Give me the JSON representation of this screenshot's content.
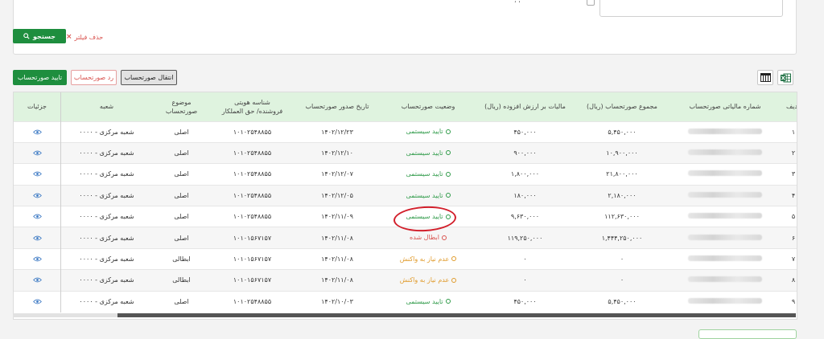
{
  "filter": {
    "clear_label": "حذف فیلتر",
    "search_label": "جستجو",
    "label_fragment": "، ،"
  },
  "actions": {
    "approve_label": "تایید صورتحساب",
    "reject_label": "رد صورتحساب",
    "transfer_label": "انتقال صورتحساب"
  },
  "table": {
    "headers": {
      "row": "ردیف",
      "tax_number": "شماره مالیاتی صورتحساب",
      "total": "مجموع صورتحساب (ریال)",
      "vat": "مالیات بر ارزش افزوده (ریال)",
      "status": "وضعیت صورتحساب",
      "issue_date": "تاریخ صدور صورتحساب",
      "id_line1": "شناسه هویتی",
      "id_line2": "فروشنده/ حق العملکار",
      "subject": "موضوع صورتحساب",
      "branch": "شعبه",
      "details": "جزئیات"
    },
    "rows": [
      {
        "row": "۱",
        "total": "۵,۴۵۰,۰۰۰",
        "vat": "۴۵۰,۰۰۰",
        "status": "تایید سیستمی",
        "status_type": "approved",
        "date": "۱۴۰۲/۱۲/۲۳",
        "id": "۱۰۱۰۲۵۴۸۸۵۵",
        "subject": "اصلی",
        "branch": "شعبه مرکزی - ۰۰۰۰"
      },
      {
        "row": "۲",
        "total": "۱۰,۹۰۰,۰۰۰",
        "vat": "۹۰۰,۰۰۰",
        "status": "تایید سیستمی",
        "status_type": "approved",
        "date": "۱۴۰۲/۱۲/۱۰",
        "id": "۱۰۱۰۲۵۴۸۸۵۵",
        "subject": "اصلی",
        "branch": "شعبه مرکزی - ۰۰۰۰"
      },
      {
        "row": "۳",
        "total": "۲۱,۸۰۰,۰۰۰",
        "vat": "۱,۸۰۰,۰۰۰",
        "status": "تایید سیستمی",
        "status_type": "approved",
        "date": "۱۴۰۲/۱۲/۰۷",
        "id": "۱۰۱۰۲۵۴۸۸۵۵",
        "subject": "اصلی",
        "branch": "شعبه مرکزی - ۰۰۰۰"
      },
      {
        "row": "۴",
        "total": "۲,۱۸۰,۰۰۰",
        "vat": "۱۸۰,۰۰۰",
        "status": "تایید سیستمی",
        "status_type": "approved",
        "date": "۱۴۰۲/۱۲/۰۵",
        "id": "۱۰۱۰۲۵۴۸۸۵۵",
        "subject": "اصلی",
        "branch": "شعبه مرکزی - ۰۰۰۰"
      },
      {
        "row": "۵",
        "total": "۱۱۲,۶۳۰,۰۰۰",
        "vat": "۹,۶۳۰,۰۰۰",
        "status": "تایید سیستمی",
        "status_type": "approved",
        "date": "۱۴۰۲/۱۱/۰۹",
        "id": "۱۰۱۰۲۵۴۸۸۵۵",
        "subject": "اصلی",
        "branch": "شعبه مرکزی - ۰۰۰۰"
      },
      {
        "row": "۶",
        "total": "۱,۴۴۴,۲۵۰,۰۰۰",
        "vat": "۱۱۹,۲۵۰,۰۰۰",
        "status": "ابطال شده",
        "status_type": "canceled",
        "date": "۱۴۰۲/۱۱/۰۸",
        "id": "۱۰۱۰۱۵۶۷۱۵۷",
        "subject": "اصلی",
        "branch": "شعبه مرکزی - ۰۰۰۰"
      },
      {
        "row": "۷",
        "total": "۰",
        "vat": "۰",
        "status": "عدم نیاز به واکنش",
        "status_type": "noneed",
        "date": "۱۴۰۲/۱۱/۰۸",
        "id": "۱۰۱۰۱۵۶۷۱۵۷",
        "subject": "ابطالی",
        "branch": "شعبه مرکزی - ۰۰۰۰"
      },
      {
        "row": "۸",
        "total": "۰",
        "vat": "۰",
        "status": "عدم نیاز به واکنش",
        "status_type": "noneed",
        "date": "۱۴۰۲/۱۱/۰۸",
        "id": "۱۰۱۰۱۵۶۷۱۵۷",
        "subject": "ابطالی",
        "branch": "شعبه مرکزی - ۰۰۰۰"
      },
      {
        "row": "۹",
        "total": "۵,۴۵۰,۰۰۰",
        "vat": "۴۵۰,۰۰۰",
        "status": "تایید سیستمی",
        "status_type": "approved",
        "date": "۱۴۰۲/۱۰/۰۳",
        "id": "۱۰۱۰۲۵۴۸۸۵۵",
        "subject": "اصلی",
        "branch": "شعبه مرکزی - ۰۰۰۰"
      }
    ]
  },
  "colors": {
    "accent_green": "#1e8e3e",
    "approved": "#2e9a48",
    "canceled": "#d9534f",
    "noneed": "#e09a2a",
    "header_bg": "#dff3df",
    "annotation": "#d21f2b"
  },
  "icons": {
    "search": "search-icon",
    "clear": "close-icon",
    "columns": "columns-icon",
    "excel": "excel-icon",
    "details": "eye-icon"
  }
}
